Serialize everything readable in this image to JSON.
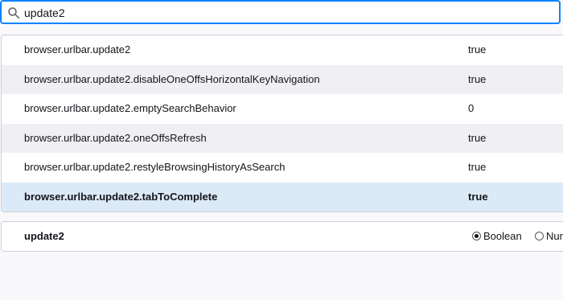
{
  "search": {
    "value": "update2",
    "icon": "search-icon"
  },
  "prefs": [
    {
      "name": "browser.urlbar.update2",
      "value": "true"
    },
    {
      "name": "browser.urlbar.update2.disableOneOffsHorizontalKeyNavigation",
      "value": "true"
    },
    {
      "name": "browser.urlbar.update2.emptySearchBehavior",
      "value": "0"
    },
    {
      "name": "browser.urlbar.update2.oneOffsRefresh",
      "value": "true"
    },
    {
      "name": "browser.urlbar.update2.restyleBrowsingHistoryAsSearch",
      "value": "true"
    },
    {
      "name": "browser.urlbar.update2.tabToComplete",
      "value": "true",
      "selected": true
    }
  ],
  "new_pref": {
    "name": "update2",
    "types": [
      {
        "label": "Boolean",
        "checked": true
      },
      {
        "label": "Number",
        "checked": false
      }
    ]
  },
  "colors": {
    "accent": "#0a84ff",
    "selected_row": "#dceaf7",
    "alt_row": "#f0f0f4"
  }
}
